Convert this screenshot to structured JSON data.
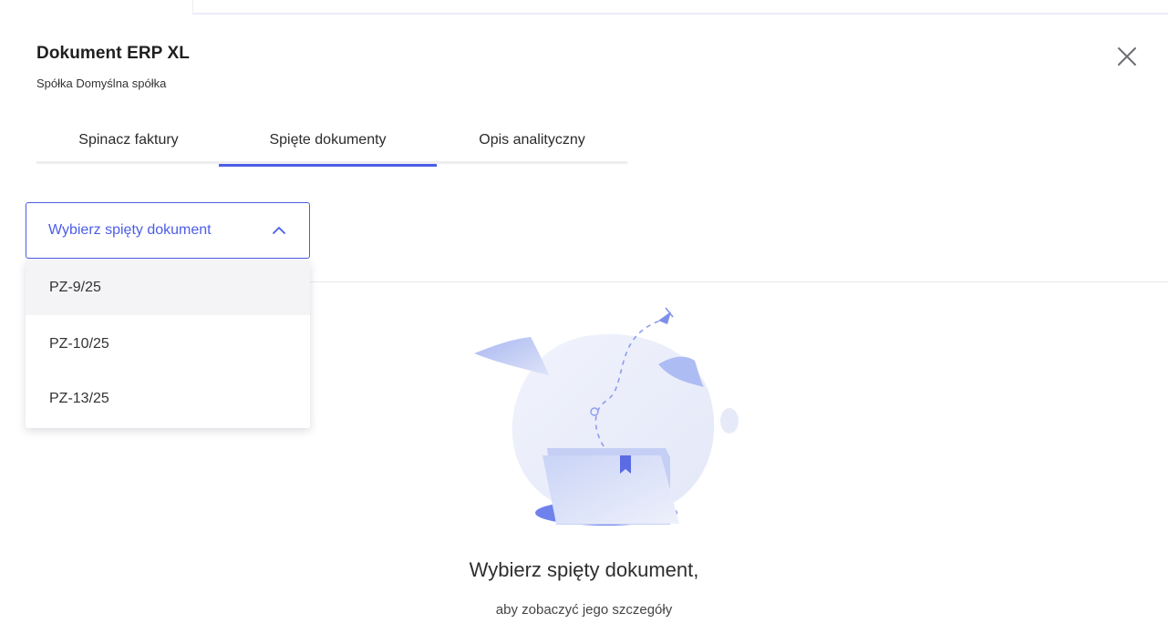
{
  "header": {
    "title": "Dokument ERP XL",
    "subtitle": "Spółka Domyślna spółka"
  },
  "tabs": [
    {
      "label": "Spinacz faktury",
      "active": false
    },
    {
      "label": "Spięte dokumenty",
      "active": true
    },
    {
      "label": "Opis analityczny",
      "active": false
    }
  ],
  "select": {
    "placeholder": "Wybierz spięty dokument",
    "expanded": true,
    "options": [
      "PZ-9/25",
      "PZ-10/25",
      "PZ-13/25"
    ]
  },
  "empty_state": {
    "title": "Wybierz spięty dokument,",
    "subtitle": "aby zobaczyć jego szczegóły"
  },
  "colors": {
    "accent": "#4c5de8",
    "text": "#2b2b2b",
    "hover_option": "#f4f4f7",
    "illustration_light": "#e7ecfb",
    "illustration_mid": "#aebcf4"
  },
  "icons": {
    "close": "close-icon",
    "chevron": "chevron-up-icon"
  }
}
